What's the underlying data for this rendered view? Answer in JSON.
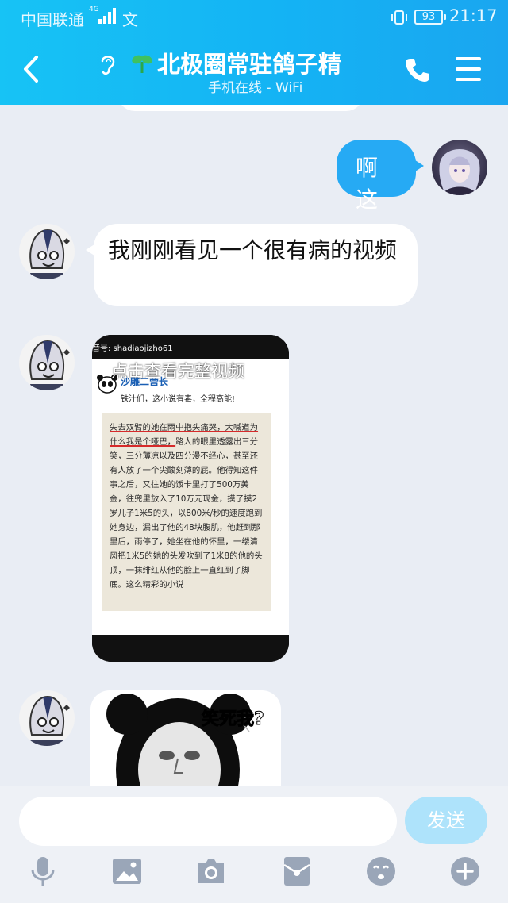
{
  "status_bar": {
    "carrier": "中国联通",
    "network": "4G",
    "extra_glyph": "文",
    "battery": "93",
    "time": "21:17"
  },
  "header": {
    "title": "北极圈常驻鸽子精",
    "subtitle": "手机在线 - WiFi"
  },
  "messages": {
    "sent_1": "啊这",
    "received_1": "我刚刚看见一个很有病的视频",
    "video": {
      "account": "音号: shadiaojizho61",
      "overlay_hint": "点击查看完整视频",
      "author": "沙雕二营长",
      "intro": "铁汁们，这小说有毒，全程高能!",
      "text_highlight": "失去双臂的她在雨中抱头痛哭，大喊道为什么我是个哑巴，",
      "text_body": "路人的眼里透露出三分笑，三分薄凉以及四分漫不经心，甚至还有人放了一个尖酸刻薄的屁。他得知这件事之后，又往她的饭卡里打了500万美金，往兜里放入了10万元现金，摸了摸2岁儿子1米5的头，以800米/秒的速度跑到她身边，漏出了他的48块腹肌，他赶到那里后，雨停了，她坐在他的怀里，一缕清风把1米5的她的头发吹到了1米8的他的头顶，一抹绯红从他的脸上一直红到了脚底。这么精彩的小说"
    },
    "meme_caption": "笑死我?"
  },
  "input": {
    "placeholder": "",
    "send_label": "发送"
  },
  "colors": {
    "header": "#17c3f5",
    "bubble_me": "#26aaf4",
    "send_disabled": "#aee3fb"
  },
  "toolbar_icons": [
    "microphone-icon",
    "image-icon",
    "camera-icon",
    "red-packet-icon",
    "emoji-icon",
    "plus-icon"
  ]
}
